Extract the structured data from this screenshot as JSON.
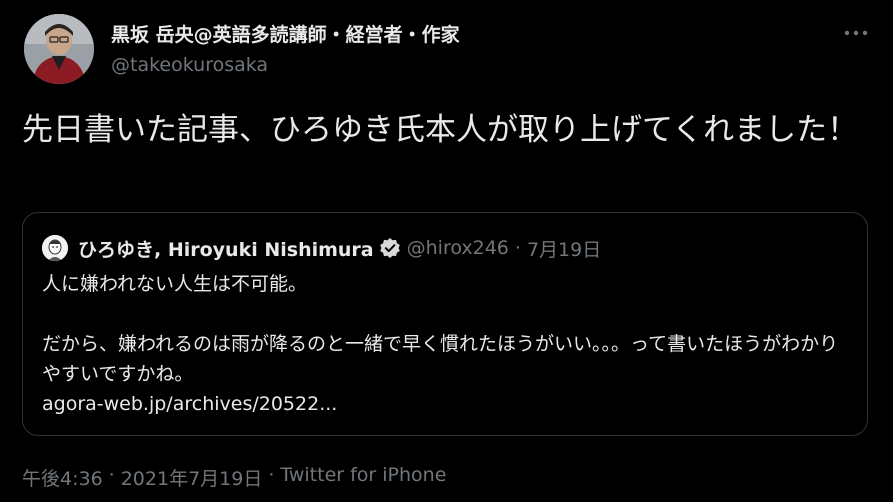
{
  "author": {
    "display_name": "黒坂 岳央@英語多読講師・経営者・作家",
    "handle": "@takeokurosaka"
  },
  "tweet": {
    "text": "先日書いた記事、ひろゆき氏本人が取り上げてくれました！"
  },
  "quoted_tweet": {
    "display_name": "ひろゆき, Hiroyuki Nishimura",
    "handle": "@hirox246",
    "separator": "·",
    "date": "7月19日",
    "line1": "人に嫌われない人生は不可能。",
    "line2": "だから、嫌われるのは雨が降るのと一緒で早く慣れたほうがいい。。。って書いたほうがわかりやすいですかね。",
    "link": "agora-web.jp/archives/20522..."
  },
  "meta": {
    "time": "午後4:36",
    "separator": "·",
    "date": "2021年7月19日",
    "source": "Twitter for iPhone"
  },
  "icons": {
    "more": "more-horizontal-icon",
    "verified": "verified-badge-icon"
  },
  "colors": {
    "background": "#000000",
    "primary_text": "#e7e9ea",
    "secondary_text": "#71767b",
    "border": "#2f3336"
  }
}
